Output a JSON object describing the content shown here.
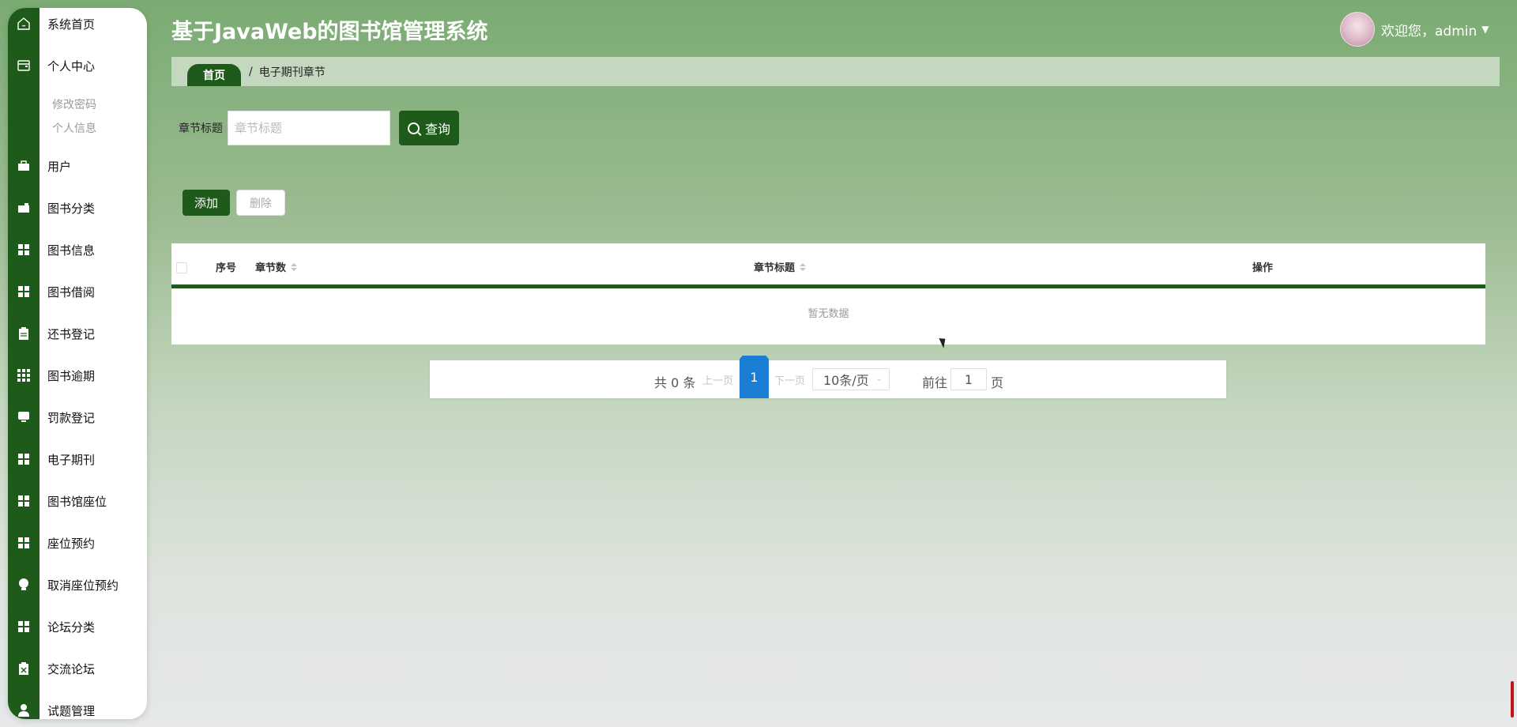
{
  "app": {
    "title": "基于JavaWeb的图书馆管理系统",
    "welcome": "欢迎您，admin"
  },
  "sidebar": {
    "items": [
      {
        "label": "系统首页",
        "icon": "home-icon"
      },
      {
        "label": "个人中心",
        "icon": "wallet-icon"
      },
      {
        "label": "用户",
        "icon": "briefcase-icon"
      },
      {
        "label": "图书分类",
        "icon": "wallet-icon"
      },
      {
        "label": "图书信息",
        "icon": "grid-icon"
      },
      {
        "label": "图书借阅",
        "icon": "grid-icon"
      },
      {
        "label": "还书登记",
        "icon": "clipboard-icon"
      },
      {
        "label": "图书逾期",
        "icon": "grid-icon"
      },
      {
        "label": "罚款登记",
        "icon": "monitor-icon"
      },
      {
        "label": "电子期刊",
        "icon": "grid-icon"
      },
      {
        "label": "图书馆座位",
        "icon": "grid-icon"
      },
      {
        "label": "座位预约",
        "icon": "grid-icon"
      },
      {
        "label": "取消座位预约",
        "icon": "bulb-icon"
      },
      {
        "label": "论坛分类",
        "icon": "grid-icon"
      },
      {
        "label": "交流论坛",
        "icon": "clipboard-icon"
      },
      {
        "label": "试题管理",
        "icon": "user-icon"
      }
    ],
    "sub_items": [
      "修改密码",
      "个人信息"
    ]
  },
  "breadcrumb": {
    "home": "首页",
    "separator": "/",
    "current": "电子期刊章节"
  },
  "search": {
    "label": "章节标题",
    "placeholder": "章节标题",
    "value": "",
    "button": "查询"
  },
  "actions": {
    "add": "添加",
    "delete": "删除"
  },
  "table": {
    "columns": [
      "序号",
      "章节数",
      "章节标题",
      "操作"
    ],
    "rows": [],
    "empty_text": "暂无数据"
  },
  "pagination": {
    "total": "共 0 条",
    "prev": "上一页",
    "current_page": "1",
    "next": "下一页",
    "page_size": "10条/页",
    "goto": "前往",
    "goto_value": "1",
    "page_unit": "页"
  },
  "colors": {
    "primary": "#1e5a1a",
    "page_link": "#1a7fd4"
  }
}
